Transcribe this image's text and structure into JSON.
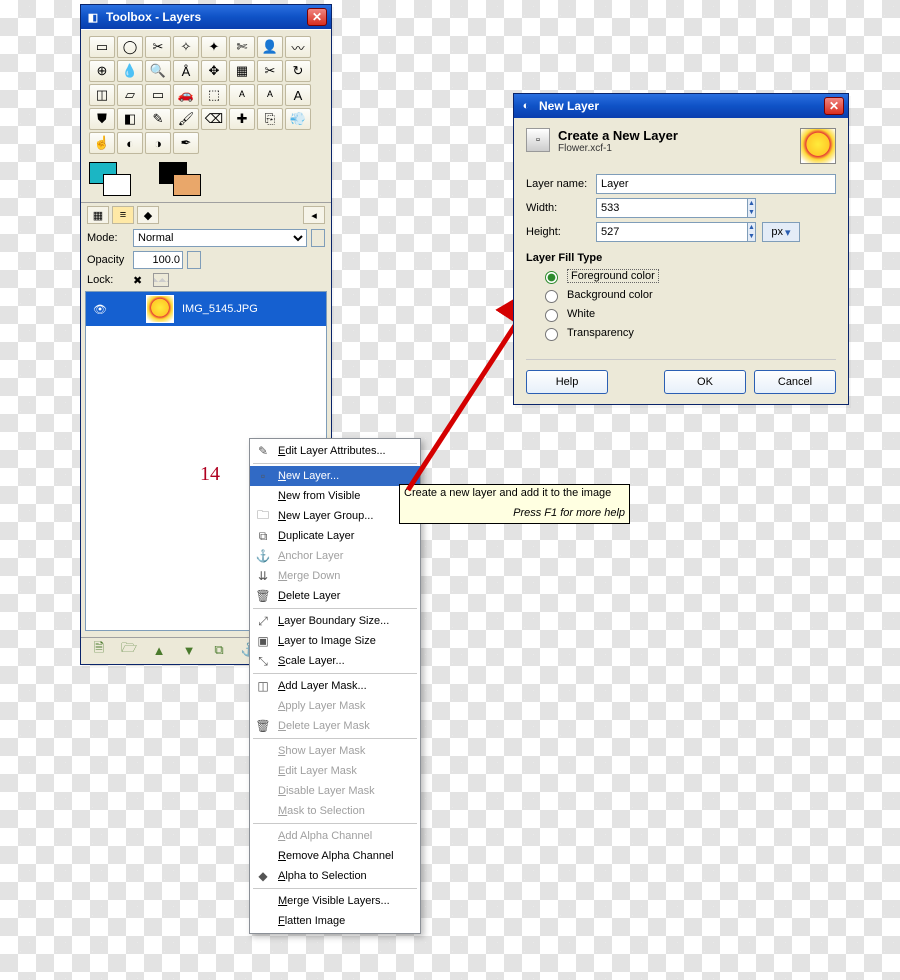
{
  "toolbox": {
    "title": "Toolbox - Layers",
    "mode_label": "Mode:",
    "mode_value": "Normal",
    "opacity_label": "Opacity",
    "opacity_value": "100.0",
    "lock_label": "Lock:",
    "layer_name": "IMG_5145.JPG",
    "tools": [
      "rect-select",
      "ellipse-select",
      "free-select",
      "fuzzy-select",
      "by-color-select",
      "scissors",
      "foreground-select",
      "paths",
      "color-picker",
      "eyedropper",
      "zoom",
      "measure",
      "move",
      "align",
      "crop",
      "rotate",
      "scale",
      "shear",
      "perspective",
      "flip",
      "cage",
      "text",
      "text-bold",
      "text-a",
      "bucket",
      "blend",
      "pencil",
      "paintbrush",
      "eraser",
      "heal",
      "clone",
      "airbrush",
      "smudge",
      "blur",
      "dodge",
      "ink"
    ],
    "bottom_icons": [
      "new",
      "open",
      "up",
      "down",
      "duplicate",
      "anchor",
      "delete"
    ]
  },
  "callout_number": "14",
  "context_menu": {
    "items": [
      {
        "icon": "✎",
        "label": "Edit Layer Attributes...",
        "enabled": true
      },
      {
        "sep": true
      },
      {
        "icon": "▫",
        "label": "New Layer...",
        "enabled": true,
        "selected": true
      },
      {
        "icon": "",
        "label": "New from Visible",
        "enabled": true
      },
      {
        "icon": "🗀",
        "label": "New Layer Group...",
        "enabled": true
      },
      {
        "icon": "⧉",
        "label": "Duplicate Layer",
        "enabled": true
      },
      {
        "icon": "⚓",
        "label": "Anchor Layer",
        "enabled": false
      },
      {
        "icon": "⇊",
        "label": "Merge Down",
        "enabled": false
      },
      {
        "icon": "🗑",
        "label": "Delete Layer",
        "enabled": true
      },
      {
        "sep": true
      },
      {
        "icon": "⤢",
        "label": "Layer Boundary Size...",
        "enabled": true
      },
      {
        "icon": "▣",
        "label": "Layer to Image Size",
        "enabled": true
      },
      {
        "icon": "⤡",
        "label": "Scale Layer...",
        "enabled": true
      },
      {
        "sep": true
      },
      {
        "icon": "◫",
        "label": "Add Layer Mask...",
        "enabled": true
      },
      {
        "icon": "",
        "label": "Apply Layer Mask",
        "enabled": false
      },
      {
        "icon": "🗑",
        "label": "Delete Layer Mask",
        "enabled": false
      },
      {
        "sep": true
      },
      {
        "icon": "",
        "label": "Show Layer Mask",
        "enabled": false
      },
      {
        "icon": "",
        "label": "Edit Layer Mask",
        "enabled": false
      },
      {
        "icon": "",
        "label": "Disable Layer Mask",
        "enabled": false
      },
      {
        "icon": "",
        "label": "Mask to Selection",
        "enabled": false
      },
      {
        "sep": true
      },
      {
        "icon": "",
        "label": "Add Alpha Channel",
        "enabled": false
      },
      {
        "icon": "",
        "label": "Remove Alpha Channel",
        "enabled": true
      },
      {
        "icon": "◆",
        "label": "Alpha to Selection",
        "enabled": true
      },
      {
        "sep": true
      },
      {
        "icon": "",
        "label": "Merge Visible Layers...",
        "enabled": true
      },
      {
        "icon": "",
        "label": "Flatten Image",
        "enabled": true
      }
    ]
  },
  "tooltip": {
    "line1": "Create a new layer and add it to the image",
    "line2": "Press F1 for more help"
  },
  "dialog": {
    "title": "New Layer",
    "heading": "Create a New Layer",
    "subheading": "Flower.xcf-1",
    "name_label": "Layer name:",
    "name_value": "Layer",
    "width_label": "Width:",
    "width_value": "533",
    "height_label": "Height:",
    "height_value": "527",
    "unit": "px",
    "fill_heading": "Layer Fill Type",
    "fill_options": [
      "Foreground color",
      "Background color",
      "White",
      "Transparency"
    ],
    "fill_selected": 0,
    "btn_help": "Help",
    "btn_ok": "OK",
    "btn_cancel": "Cancel"
  }
}
